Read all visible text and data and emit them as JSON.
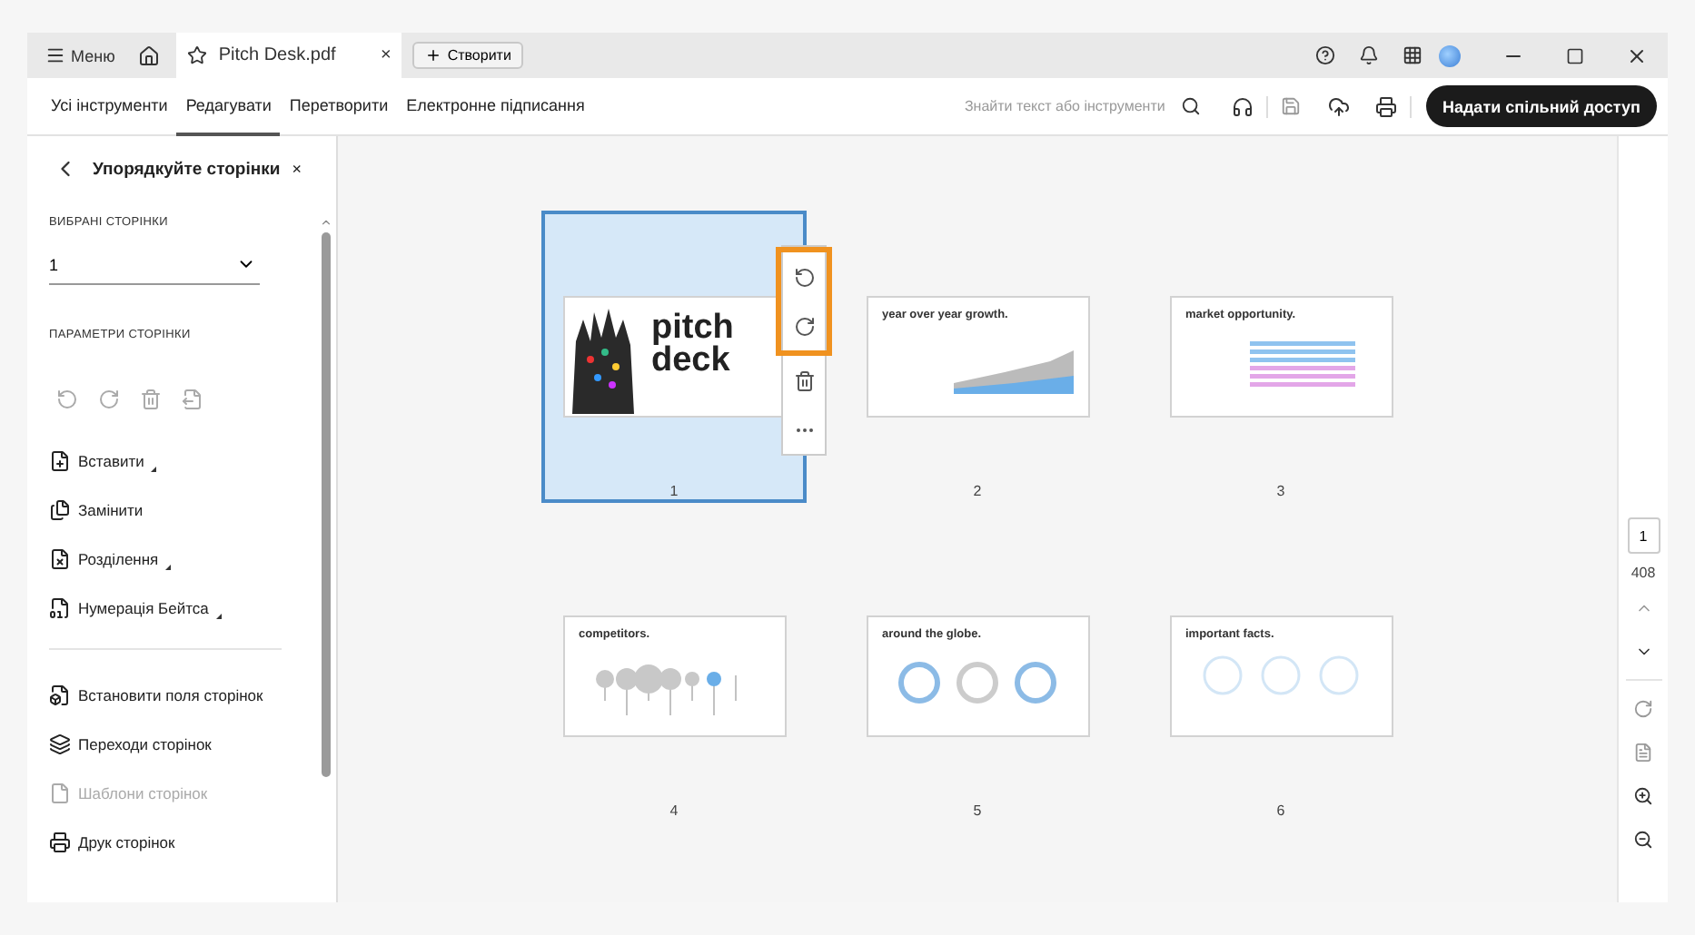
{
  "titlebar": {
    "menu": "Меню",
    "tabs": [
      {
        "label": "Pitch Desk.pdf",
        "selected": true,
        "close": "×"
      }
    ],
    "create": "Створити"
  },
  "toolbar": {
    "tabs": [
      {
        "label": "Усі інструменти",
        "selected": false
      },
      {
        "label": "Редагувати",
        "selected": true
      },
      {
        "label": "Перетворити",
        "selected": false
      },
      {
        "label": "Електронне підписання",
        "selected": false
      }
    ],
    "search": {
      "placeholder": "Знайти текст або інструменти"
    },
    "share": "Надати спільний доступ"
  },
  "panel": {
    "title": "Упорядкуйте сторінки",
    "close": "×",
    "selected_label": "ВИБРАНІ СТОРІНКИ",
    "selected_value": "1",
    "options_label": "ПАРАМЕТРИ СТОРІНКИ",
    "tools": [
      {
        "kind": "insert",
        "label": "Вставити",
        "submenu": true,
        "disabled": false
      },
      {
        "kind": "replace",
        "label": "Замінити",
        "submenu": false,
        "disabled": false
      },
      {
        "kind": "split",
        "label": "Розділення",
        "submenu": true,
        "disabled": false
      },
      {
        "kind": "bates",
        "label": "Нумерація Бейтса",
        "submenu": true,
        "disabled": false
      }
    ],
    "more": [
      {
        "kind": "margins",
        "label": "Встановити поля сторінок",
        "submenu": false,
        "disabled": false
      },
      {
        "kind": "transitions",
        "label": "Переходи сторінок",
        "submenu": false,
        "disabled": false
      },
      {
        "kind": "templates",
        "label": "Шаблони сторінок",
        "submenu": false,
        "disabled": true
      },
      {
        "kind": "print",
        "label": "Друк сторінок",
        "submenu": false,
        "disabled": false
      }
    ]
  },
  "pages": [
    {
      "number": "1",
      "kind": "cover",
      "title": "pitch deck",
      "selected": true
    },
    {
      "number": "2",
      "kind": "area",
      "title": "year over year growth.",
      "selected": false
    },
    {
      "number": "3",
      "kind": "bars",
      "title": "market opportunity.",
      "selected": false
    },
    {
      "number": "4",
      "kind": "lollipop",
      "title": "competitors.",
      "selected": false
    },
    {
      "number": "5",
      "kind": "donut",
      "title": "around the globe.",
      "selected": false
    },
    {
      "number": "6",
      "kind": "circles",
      "title": "important facts.",
      "selected": false
    }
  ],
  "page_nav": {
    "current": "1",
    "total": "408"
  }
}
